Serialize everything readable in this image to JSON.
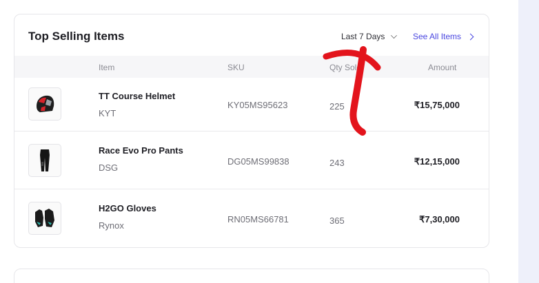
{
  "widget": {
    "title": "Top Selling Items",
    "period_label": "Last 7 Days",
    "see_all_label": "See All Items"
  },
  "table": {
    "columns": [
      "Item",
      "SKU",
      "Qty Sold",
      "Amount"
    ],
    "rows": [
      {
        "name": "TT Course Helmet",
        "brand": "KYT",
        "sku": "KY05MS95623",
        "qty": "225",
        "amount": "₹15,75,000",
        "icon": "helmet-icon"
      },
      {
        "name": "Race Evo Pro Pants",
        "brand": "DSG",
        "sku": "DG05MS99838",
        "qty": "243",
        "amount": "₹12,15,000",
        "icon": "pants-icon"
      },
      {
        "name": "H2GO Gloves",
        "brand": "Rynox",
        "sku": "RN05MS66781",
        "qty": "365",
        "amount": "₹7,30,000",
        "icon": "gloves-icon"
      }
    ]
  },
  "annotation": {
    "color": "#e3141c",
    "shape": "upward-arrow"
  }
}
